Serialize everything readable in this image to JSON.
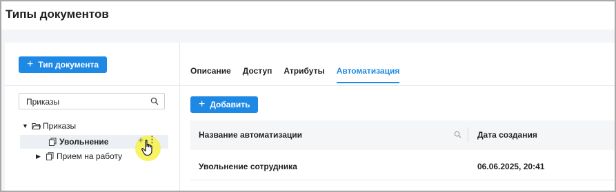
{
  "page": {
    "title": "Типы документов"
  },
  "left_panel": {
    "add_type_button": "Тип документа",
    "search_value": "Приказы",
    "tree": {
      "root_label": "Приказы",
      "children": [
        {
          "label": "Увольнение",
          "selected": true
        },
        {
          "label": "Прием на работу",
          "selected": false
        }
      ]
    }
  },
  "tabs": [
    {
      "label": "Описание",
      "active": false
    },
    {
      "label": "Доступ",
      "active": false
    },
    {
      "label": "Атрибуты",
      "active": false
    },
    {
      "label": "Автоматизация",
      "active": true
    }
  ],
  "main": {
    "add_button": "Добавить",
    "table": {
      "columns": [
        "Название автоматизации",
        "Дата создания"
      ],
      "rows": [
        {
          "name": "Увольнение сотрудника",
          "created": "06.06.2025, 20:41"
        }
      ]
    }
  },
  "colors": {
    "accent": "#1e88e5",
    "highlight": "#f6f148"
  },
  "icons": [
    "plus-icon",
    "search-icon",
    "caret-down-icon",
    "caret-right-icon",
    "folder-open-icon",
    "documents-icon",
    "more-vertical-icon",
    "hand-pointer-icon"
  ]
}
